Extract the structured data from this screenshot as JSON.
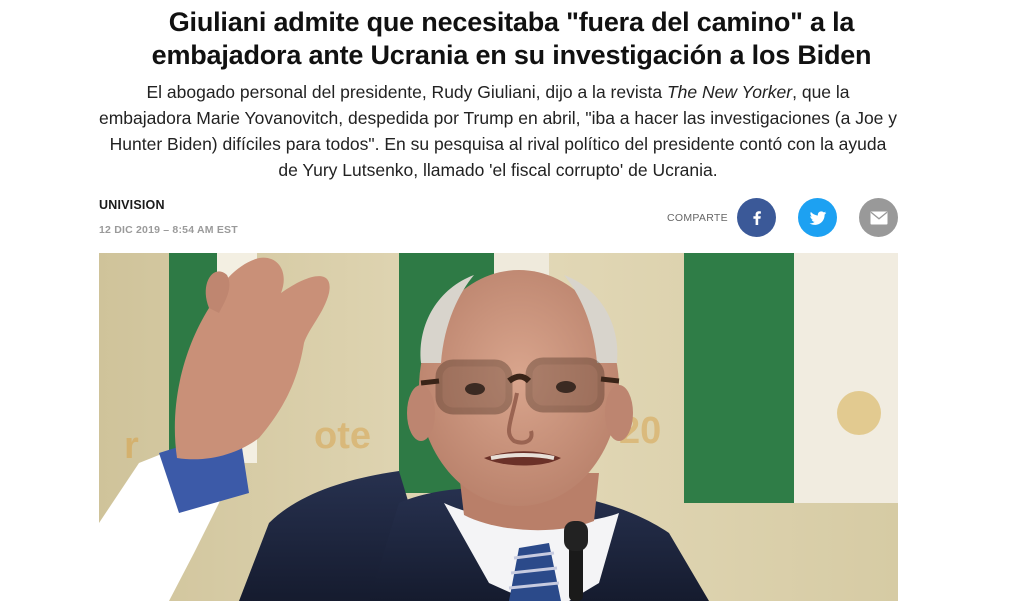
{
  "article": {
    "headline_line1": "Giuliani admite que necesitaba \"fuera del camino\" a la",
    "headline_line2": "embajadora ante Ucrania en su investigación a los Biden",
    "summary": {
      "part1": "El abogado personal del presidente, Rudy Giuliani, dijo a la revista ",
      "publication": "The New Yorker",
      "part2": ", que la embajadora Marie Yovanovitch, despedida por Trump en abril, \"iba a hacer las investigaciones (a Joe y Hunter Biden) difíciles para todos\". En su pesquisa al rival político del presidente contó con la ayuda de Yury Lutsenko, llamado 'el fiscal corrupto' de Ucrania."
    },
    "source": "UNIVISION",
    "timestamp": "12 DIC 2019 – 8:54 AM EST"
  },
  "share": {
    "label": "COMPARTE",
    "buttons": [
      {
        "network": "facebook",
        "icon": "facebook-icon",
        "color": "#3b5998"
      },
      {
        "network": "twitter",
        "icon": "twitter-icon",
        "color": "#1da1f2"
      },
      {
        "network": "email",
        "icon": "email-icon",
        "color": "#999999"
      }
    ]
  },
  "hero_image": {
    "subject": "rudy-giuliani-photo",
    "colors": {
      "background": "#d9cfa8",
      "flag_green": "#2e7a45",
      "suit": "#1d2640",
      "skin": "#c8907a"
    }
  }
}
